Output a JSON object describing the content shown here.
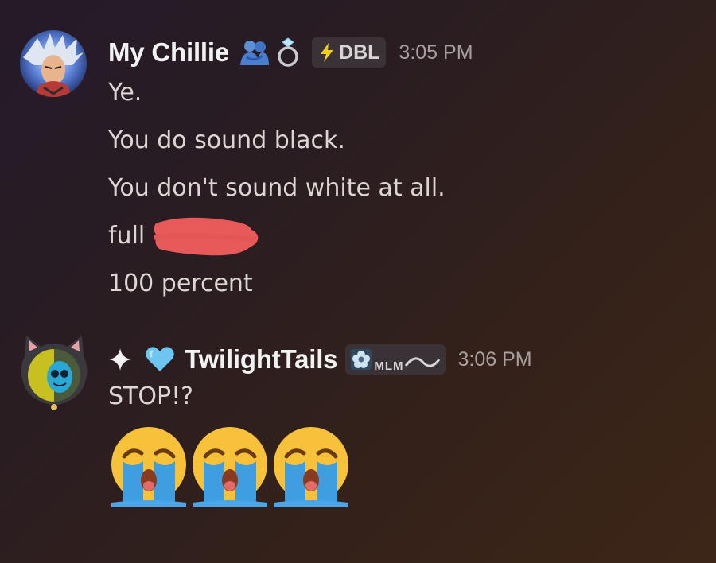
{
  "messages": [
    {
      "username": "My Chillie",
      "timestamp": "3:05 PM",
      "tag": {
        "icon": "lightning-icon",
        "text": "DBL"
      },
      "badges": [
        "people-hugging-icon",
        "ring-icon"
      ],
      "lines": [
        "Ye.",
        "You do sound black.",
        "You don't sound white at all.",
        "full",
        "100 percent"
      ],
      "redaction_color": "#e8595a"
    },
    {
      "username": "TwilightTails",
      "timestamp": "3:06 PM",
      "prefix_icons": [
        "sparkle-icon",
        "blue-heart-icon"
      ],
      "tag": {
        "icon": "flower-icon",
        "text": "MLM"
      },
      "name_color": "#f2f2f2",
      "lines": [
        "STOP!?"
      ],
      "emojis": [
        "loudly-crying-face-icon",
        "loudly-crying-face-icon",
        "loudly-crying-face-icon"
      ]
    }
  ],
  "colors": {
    "username": "#f2f2f2",
    "text": "#dcd7d3",
    "timestamp": "#a6a0a0",
    "heart": "#6ec6f0",
    "tag_bg": "#3a3236"
  }
}
